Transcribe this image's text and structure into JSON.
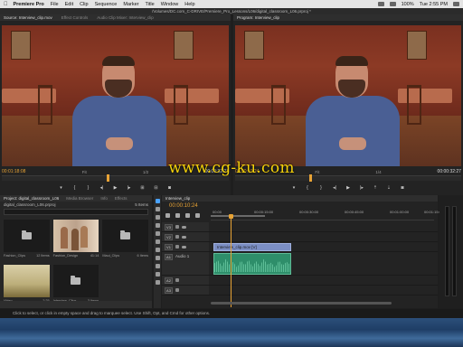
{
  "menubar": {
    "apple": "",
    "app": "Premiere Pro",
    "items": [
      "File",
      "Edit",
      "Clip",
      "Sequence",
      "Marker",
      "Title",
      "Window",
      "Help"
    ],
    "status": {
      "battery": "100%",
      "time": "Tue 2:55 PM"
    }
  },
  "path": "/Volumes/DC.com_C-DRIVE/Premiere_Pro_Lessons/L06/digital_classroom_L06.prproj *",
  "source": {
    "tabs": [
      "Source: Interview_clip.mov",
      "Effect Controls",
      "Audio Clip Mixer: Interview_clip"
    ],
    "tc_in": "00:01:18:08",
    "fit": "Fit",
    "zoom": "1/2",
    "tc_dur": "00:00:32:27"
  },
  "program": {
    "tabs": [
      "Program: Interview_clip"
    ],
    "tc_in": "00:00:10:24",
    "fit": "Fit",
    "zoom": "1/4",
    "tc_dur": "00:00:32:27"
  },
  "watermark": "www.cg-ku.com",
  "project": {
    "tabs": [
      "Project: digital_classroom_L06",
      "Media Browser",
      "Info",
      "Effects"
    ],
    "file": "digital_classroom_L06.prproj",
    "count": "5 Items",
    "bins": [
      {
        "name": "Fashion_Clips",
        "meta": "12 Items",
        "kind": "folder"
      },
      {
        "name": "Fashion_Design",
        "meta": "41:14",
        "kind": "fashion"
      },
      {
        "name": "Maui_Clips",
        "meta": "6 Items",
        "kind": "folder"
      },
      {
        "name": "Video",
        "meta": "2:25",
        "kind": "video"
      },
      {
        "name": "Interview_Clips",
        "meta": "3 Items",
        "kind": "folder"
      }
    ]
  },
  "timeline": {
    "tab": "Interview_clip",
    "tc": "00:00:10:24",
    "ruler": [
      "00:00",
      "00:00:15:00",
      "00:00:30:00",
      "00:00:45:00",
      "00:01:00:00",
      "00:01:15:00"
    ],
    "tracks": [
      {
        "tag": "V3",
        "label": ""
      },
      {
        "tag": "V2",
        "label": ""
      },
      {
        "tag": "V1",
        "label": "V1"
      },
      {
        "tag": "A1",
        "label": "Audio 1"
      },
      {
        "tag": "A2",
        "label": ""
      },
      {
        "tag": "A3",
        "label": ""
      }
    ],
    "video_clip": "Interview_clip.mov [V]"
  },
  "statusbar": "Click to select, or click in empty space and drag to marquee select. Use Shift, Opt, and Cmd for other options.",
  "colors": {
    "timecode": "#e8a335",
    "video_clip": "#7b8ec4",
    "audio_clip": "#2e8e6a",
    "watermark": "#f5d20a"
  }
}
